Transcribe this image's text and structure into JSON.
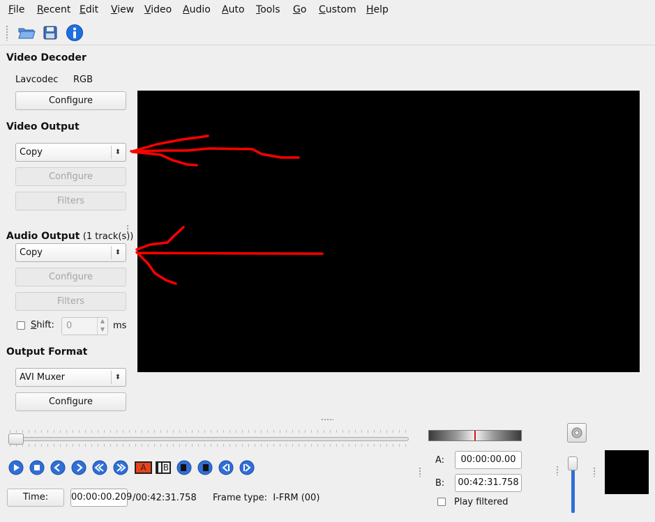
{
  "menu": [
    {
      "label": "File",
      "key": "F",
      "rest": "ile"
    },
    {
      "label": "Recent",
      "key": "R",
      "rest": "ecent"
    },
    {
      "label": "Edit",
      "key": "E",
      "rest": "dit"
    },
    {
      "label": "View",
      "key": "V",
      "rest": "iew"
    },
    {
      "label": "Video",
      "key": "V",
      "rest": "ideo"
    },
    {
      "label": "Audio",
      "key": "A",
      "rest": "udio"
    },
    {
      "label": "Auto",
      "key": "A",
      "rest": "uto"
    },
    {
      "label": "Tools",
      "key": "T",
      "rest": "ools"
    },
    {
      "label": "Go",
      "key": "G",
      "rest": "o"
    },
    {
      "label": "Custom",
      "key": "C",
      "rest": "ustom"
    },
    {
      "label": "Help",
      "key": "H",
      "rest": "elp"
    }
  ],
  "toolbar": {
    "icons": [
      "open-folder-icon",
      "save-disk-icon",
      "info-icon"
    ]
  },
  "video_decoder": {
    "title": "Video Decoder",
    "codec": "Lavcodec",
    "colorspace": "RGB",
    "configure": "Configure"
  },
  "video_output": {
    "title": "Video Output",
    "selected": "Copy",
    "configure": "Configure",
    "filters": "Filters"
  },
  "audio_output": {
    "title": "Audio Output",
    "tracks": "(1 track(s))",
    "selected": "Copy",
    "configure": "Configure",
    "filters": "Filters",
    "shift_label": "Shift:",
    "shift_key": "S",
    "shift_rest": "hift:",
    "shift_value": "0",
    "shift_unit": "ms"
  },
  "output_format": {
    "title": "Output Format",
    "selected": "AVI Muxer",
    "configure": "Configure"
  },
  "annotations": {
    "color": "#ff0000"
  },
  "bottom": {
    "time_button": "Time:",
    "current_time": "00:00:00.209",
    "total_time": "/00:42:31.758",
    "frame_type": "Frame type:  I-FRM (00)",
    "a_label": "A:",
    "a_time": "00:00:00.00",
    "b_label": "B:",
    "b_time": "00:42:31.758",
    "play_filtered": "Play filtered",
    "marker_a": "A",
    "marker_b": "B"
  },
  "colors": {
    "accent_blue": "#2f6fd6",
    "video_bg": "#000000"
  }
}
